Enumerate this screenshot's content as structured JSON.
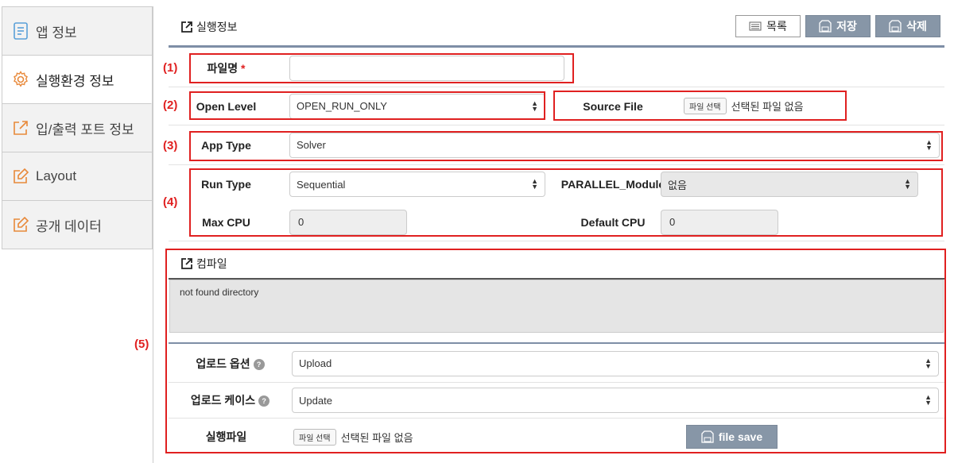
{
  "sidebar": {
    "items": [
      {
        "label": "앱 정보",
        "icon": "document-icon"
      },
      {
        "label": "실행환경 정보",
        "icon": "gear-icon"
      },
      {
        "label": "입/출력 포트 정보",
        "icon": "external-link-icon"
      },
      {
        "label": "Layout",
        "icon": "edit-icon"
      },
      {
        "label": "공개 데이터",
        "icon": "edit-icon"
      }
    ],
    "active_index": 1
  },
  "header": {
    "title": "실행정보",
    "buttons": {
      "list": "목록",
      "save": "저장",
      "delete": "삭제"
    }
  },
  "form": {
    "filename": {
      "label": "파일명",
      "required_mark": "*",
      "value": ""
    },
    "open_level": {
      "label": "Open Level",
      "value": "OPEN_RUN_ONLY"
    },
    "source_file": {
      "label": "Source File",
      "button": "파일 선택",
      "status": "선택된 파일 없음"
    },
    "app_type": {
      "label": "App Type",
      "value": "Solver"
    },
    "run_type": {
      "label": "Run Type",
      "value": "Sequential"
    },
    "parallel_module": {
      "label": "PARALLEL_Module",
      "value": "없음"
    },
    "max_cpu": {
      "label": "Max CPU",
      "value": "0"
    },
    "default_cpu": {
      "label": "Default CPU",
      "value": "0"
    }
  },
  "compile": {
    "title": "컴파일",
    "output": "not found directory",
    "upload_option": {
      "label": "업로드 옵션",
      "value": "Upload"
    },
    "upload_case": {
      "label": "업로드 케이스",
      "value": "Update"
    },
    "exec_file": {
      "label": "실행파일",
      "button": "파일 선택",
      "status": "선택된 파일 없음"
    },
    "file_save": "file save"
  },
  "annotations": [
    "(1)",
    "(2)",
    "(3)",
    "(4)",
    "(5)"
  ],
  "colors": {
    "accent": "#8796a7",
    "annotation": "#e02020",
    "header_line": "#7e8ea6"
  }
}
